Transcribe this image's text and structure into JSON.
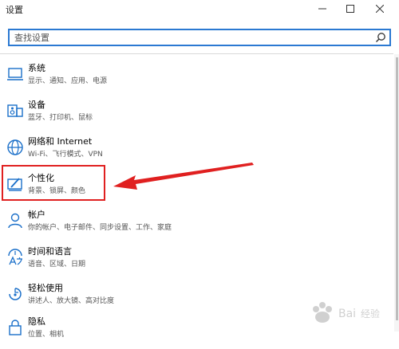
{
  "window": {
    "title": "设置",
    "minimize": "—",
    "maximize": "☐",
    "close": "✕"
  },
  "search": {
    "placeholder": "查找设置",
    "value": ""
  },
  "categories": [
    {
      "title": "系统",
      "subtitle": "显示、通知、应用、电源",
      "icon": "laptop-icon"
    },
    {
      "title": "设备",
      "subtitle": "蓝牙、打印机、鼠标",
      "icon": "devices-icon"
    },
    {
      "title": "网络和 Internet",
      "subtitle": "Wi-Fi、飞行模式、VPN",
      "icon": "globe-icon"
    },
    {
      "title": "个性化",
      "subtitle": "背景、锁屏、颜色",
      "icon": "personalization-icon"
    },
    {
      "title": "帐户",
      "subtitle": "你的帐户、电子邮件、同步设置、工作、家庭",
      "icon": "person-icon"
    },
    {
      "title": "时间和语言",
      "subtitle": "语音、区域、日期",
      "icon": "time-language-icon"
    },
    {
      "title": "轻松使用",
      "subtitle": "讲述人、放大镜、高对比度",
      "icon": "ease-of-access-icon"
    },
    {
      "title": "隐私",
      "subtitle": "位置、相机",
      "icon": "lock-icon"
    }
  ],
  "annotation": {
    "highlight_color": "#e02020",
    "accent_color": "#2b79d2"
  }
}
